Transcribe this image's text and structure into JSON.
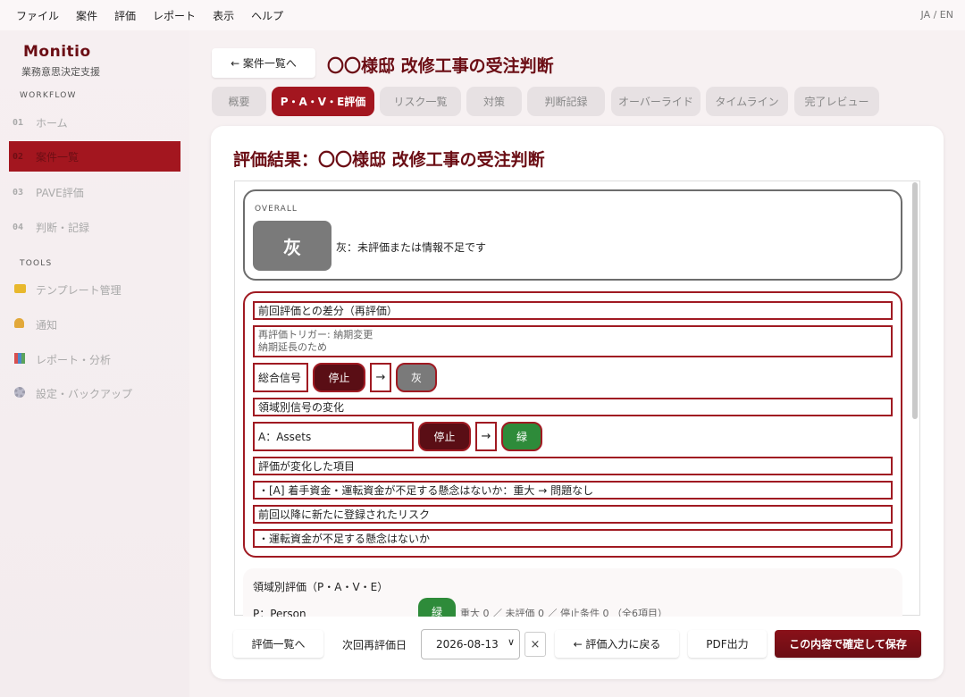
{
  "menu": [
    "ファイル",
    "案件",
    "評価",
    "レポート",
    "表示",
    "ヘルプ"
  ],
  "lang": "JA / EN",
  "sidebar": {
    "brand": "Monitio",
    "subtitle": "業務意思決定支援",
    "workflow_label": "WORKFLOW",
    "workflow": [
      {
        "num": "01",
        "label": "ホーム"
      },
      {
        "num": "02",
        "label": "案件一覧"
      },
      {
        "num": "03",
        "label": "PAVE評価"
      },
      {
        "num": "04",
        "label": "判断・記録"
      }
    ],
    "tools_label": "TOOLS",
    "tools": [
      {
        "icon": "folder-icon",
        "label": "テンプレート管理"
      },
      {
        "icon": "bell-icon",
        "label": "通知"
      },
      {
        "icon": "chart-icon",
        "label": "レポート・分析"
      },
      {
        "icon": "gear-icon",
        "label": "設定・バックアップ"
      }
    ]
  },
  "header": {
    "back": "← 案件一覧へ",
    "title": "〇〇様邸 改修工事の受注判断"
  },
  "tabs": [
    "概要",
    "P・A・V・E評価",
    "リスク一覧",
    "対策",
    "判断記録",
    "オーバーライド",
    "タイムライン",
    "完了レビュー"
  ],
  "result": {
    "title": "評価結果：〇〇様邸 改修工事の受注判断",
    "overall_label": "OVERALL",
    "overall_signal": "灰",
    "overall_text": "灰：未評価または情報不足です"
  },
  "diff": {
    "heading": "前回評価との差分（再評価）",
    "trigger": "再評価トリガー: 納期変更",
    "reason": "納期延長のため",
    "total_label": "総合信号",
    "total_from": "停止",
    "arrow": "→",
    "total_to": "灰",
    "domain_heading": "領域別信号の変化",
    "domain_label": "A：Assets",
    "domain_from": "停止",
    "domain_to": "緑",
    "changed_heading": "評価が変化した項目",
    "changed_item": "・[A] 着手資金・運転資金が不足する懸念はないか：重大 → 問題なし",
    "new_risk_heading": "前回以降に新たに登録されたリスク",
    "new_risk_item": "・運転資金が不足する懸念はないか"
  },
  "domain_eval": {
    "heading": "領域別評価（P・A・V・E）",
    "p_label": "P：Person",
    "p_signal": "緑",
    "p_stats": "重大 0 ／ 未評価 0 ／ 停止条件 0 （全6項目）"
  },
  "footer": {
    "list_btn": "評価一覧へ",
    "next_label": "次回再評価日",
    "date": "2026-08-13",
    "clear": "×",
    "back_btn": "← 評価入力に戻る",
    "pdf_btn": "PDF出力",
    "confirm_btn": "この内容で確定して保存"
  }
}
